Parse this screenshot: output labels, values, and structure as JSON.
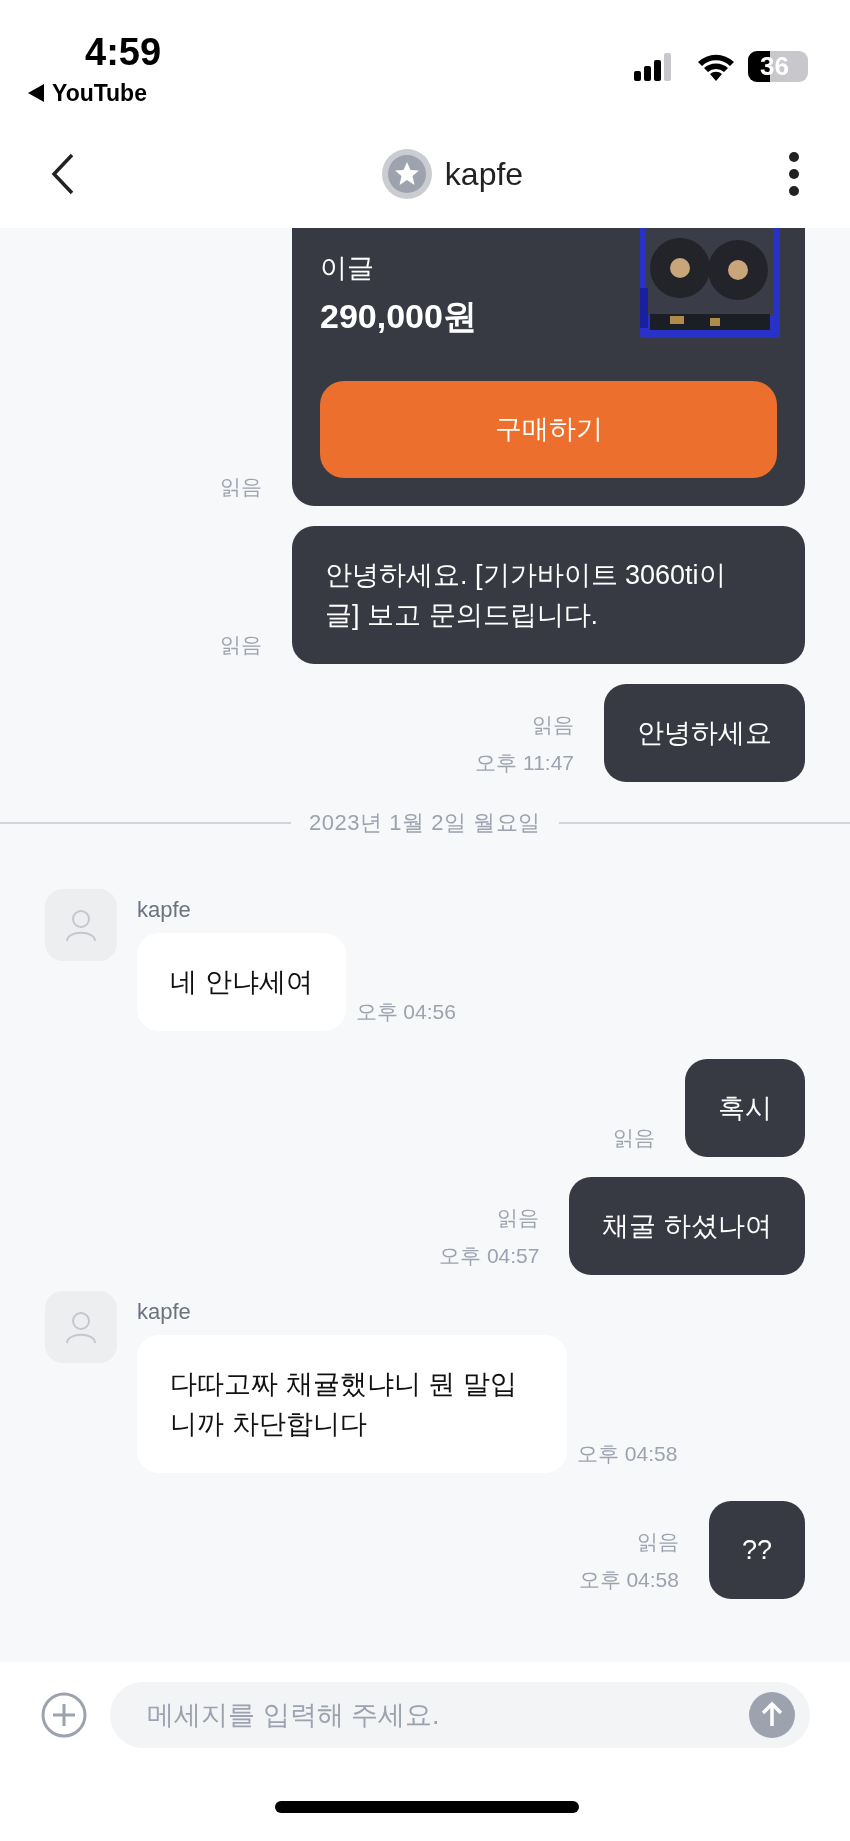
{
  "status_bar": {
    "time": "4:59",
    "back_app": "YouTube",
    "battery": "36"
  },
  "header": {
    "title": "kapfe"
  },
  "messages": [
    {
      "kind": "product",
      "title": "이글",
      "price": "290,000원",
      "button": "구매하기",
      "read": "읽음"
    },
    {
      "kind": "sent",
      "text": "안녕하세요. [기가바이트 3060ti이글] 보고 문의드립니다.",
      "read": "읽음"
    },
    {
      "kind": "sent",
      "text": "안녕하세요",
      "read": "읽음",
      "time": "오후 11:47"
    },
    {
      "kind": "date",
      "text": "2023년 1월 2일 월요일"
    },
    {
      "kind": "received",
      "sender": "kapfe",
      "text": "네 안냐세여",
      "time": "오후 04:56"
    },
    {
      "kind": "sent",
      "text": "혹시",
      "read": "읽음"
    },
    {
      "kind": "sent",
      "text": "채굴 하셨나여",
      "read": "읽음",
      "time": "오후 04:57"
    },
    {
      "kind": "received",
      "sender": "kapfe",
      "text": "다따고짜 채귤했냐니 뭔 말입니까 차단합니다",
      "time": "오후 04:58"
    },
    {
      "kind": "sent",
      "text": "??",
      "read": "읽음",
      "time": "오후 04:58"
    }
  ],
  "composer": {
    "placeholder": "메세지를 입력해 주세요."
  }
}
